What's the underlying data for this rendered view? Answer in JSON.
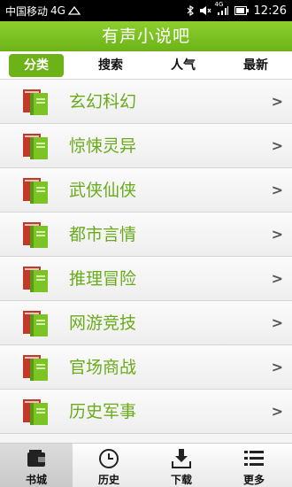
{
  "status_bar": {
    "carrier": "中国移动",
    "network": "4G",
    "signal_network": "4G",
    "time": "12:26"
  },
  "header": {
    "title": "有声小说吧"
  },
  "tabs": [
    {
      "label": "分类",
      "active": true
    },
    {
      "label": "搜索",
      "active": false
    },
    {
      "label": "人气",
      "active": false
    },
    {
      "label": "最新",
      "active": false
    }
  ],
  "categories": [
    {
      "label": "玄幻科幻",
      "chevron": ">"
    },
    {
      "label": "惊悚灵异",
      "chevron": ">"
    },
    {
      "label": "武侠仙侠",
      "chevron": ">"
    },
    {
      "label": "都市言情",
      "chevron": ">"
    },
    {
      "label": "推理冒险",
      "chevron": ">"
    },
    {
      "label": "网游竞技",
      "chevron": ">"
    },
    {
      "label": "官场商战",
      "chevron": ">"
    },
    {
      "label": "历史军事",
      "chevron": ">"
    }
  ],
  "bottom_nav": [
    {
      "label": "书城",
      "icon": "wallet-icon",
      "active": true
    },
    {
      "label": "历史",
      "icon": "clock-icon",
      "active": false
    },
    {
      "label": "下载",
      "icon": "download-icon",
      "active": false
    },
    {
      "label": "更多",
      "icon": "more-list-icon",
      "active": false
    }
  ],
  "colors": {
    "accent": "#6db318",
    "label_green": "#6aab1c"
  }
}
